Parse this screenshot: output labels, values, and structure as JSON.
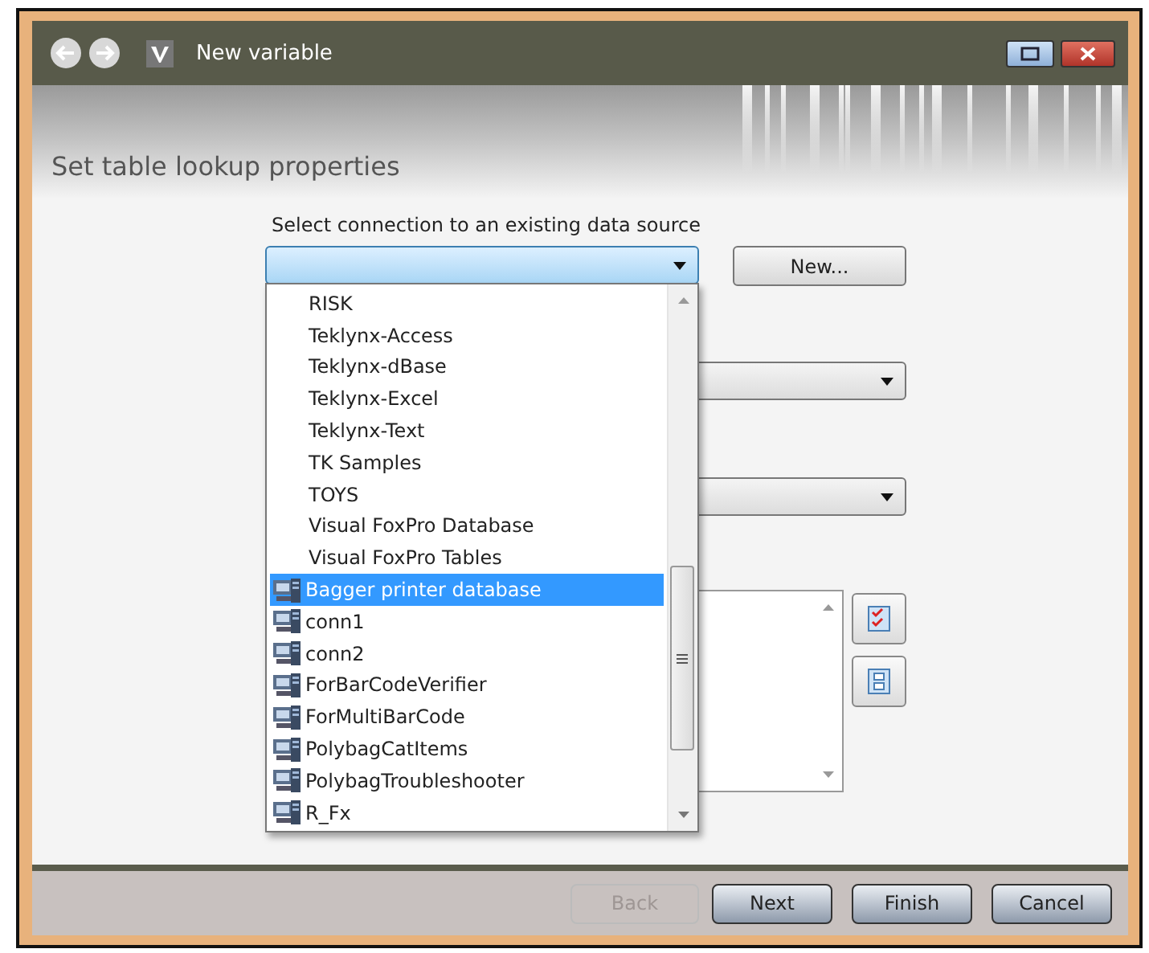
{
  "window": {
    "title": "New variable"
  },
  "header": {
    "title": "Set table lookup properties"
  },
  "connection": {
    "label": "Select connection to an existing data source",
    "expanded": true,
    "new_button": "New...",
    "options": [
      {
        "label": "RISK",
        "kind": "source",
        "selected": false
      },
      {
        "label": "Teklynx-Access",
        "kind": "source",
        "selected": false
      },
      {
        "label": "Teklynx-dBase",
        "kind": "source",
        "selected": false
      },
      {
        "label": "Teklynx-Excel",
        "kind": "source",
        "selected": false
      },
      {
        "label": "Teklynx-Text",
        "kind": "source",
        "selected": false
      },
      {
        "label": "TK Samples",
        "kind": "source",
        "selected": false
      },
      {
        "label": "TOYS",
        "kind": "source",
        "selected": false
      },
      {
        "label": "Visual FoxPro Database",
        "kind": "source",
        "selected": false
      },
      {
        "label": "Visual FoxPro Tables",
        "kind": "source",
        "selected": false
      },
      {
        "label": "Bagger printer database",
        "kind": "connection",
        "selected": true
      },
      {
        "label": "conn1",
        "kind": "connection",
        "selected": false
      },
      {
        "label": "conn2",
        "kind": "connection",
        "selected": false
      },
      {
        "label": "ForBarCodeVerifier",
        "kind": "connection",
        "selected": false
      },
      {
        "label": "ForMultiBarCode",
        "kind": "connection",
        "selected": false
      },
      {
        "label": "PolybagCatItems",
        "kind": "connection",
        "selected": false
      },
      {
        "label": "PolybagTroubleshooter",
        "kind": "connection",
        "selected": false
      },
      {
        "label": "R_Fx",
        "kind": "connection",
        "selected": false
      }
    ]
  },
  "footer": {
    "buttons": [
      {
        "label": "Back",
        "disabled": true
      },
      {
        "label": "Next",
        "disabled": false
      },
      {
        "label": "Finish",
        "disabled": false
      },
      {
        "label": "Cancel",
        "disabled": false
      }
    ]
  }
}
